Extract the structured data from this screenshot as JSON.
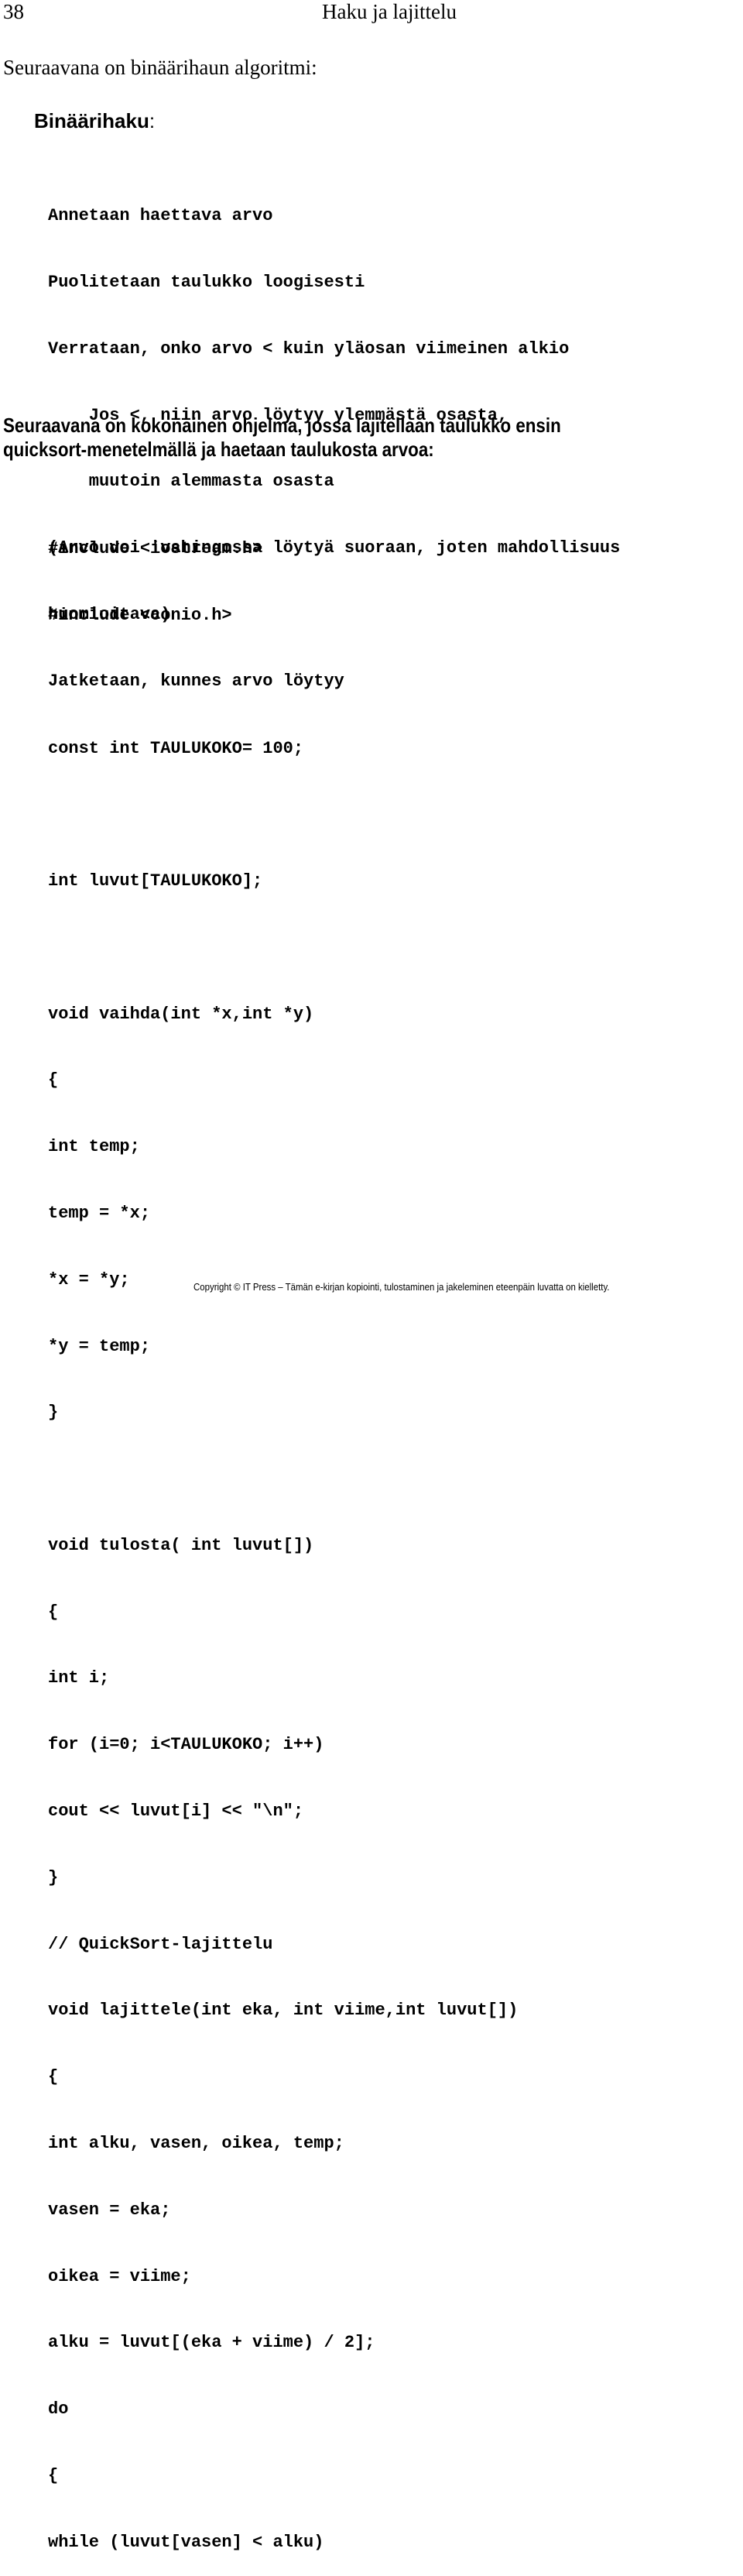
{
  "header": {
    "page_number": "38",
    "running_title": "Haku ja lajittelu"
  },
  "intro_text": "Seuraavana on binäärihaun algoritmi:",
  "algorithm": {
    "title": "Binäärihaku",
    "title_suffix": ":",
    "lines": [
      "Annetaan haettava arvo",
      "Puolitetaan taulukko loogisesti",
      "Verrataan, onko arvo < kuin yläosan viimeinen alkio",
      "    Jos <, niin arvo löytyy ylemmästä osasta,",
      "    muutoin alemmasta osasta",
      "(Arvo voi 'vahingossa löytyä suoraan, joten mahdollisuus",
      "huomioitava)",
      "Jatketaan, kunnes arvo löytyy"
    ]
  },
  "program_intro": {
    "line1": "Seuraavana on kokonainen ohjelma, jossa lajitellaan taulukko ensin",
    "line2": "quicksort-menetelmällä ja haetaan taulukosta arvoa:"
  },
  "program": {
    "includes": [
      "#include <iostream.h>",
      "#include <conio.h>"
    ],
    "const_decl": "const int TAULUKOKO= 100;",
    "array_decl": "int luvut[TAULUKOKO];",
    "swap_function": [
      "void vaihda(int *x,int *y)",
      "{",
      "int temp;",
      "temp = *x;",
      "*x = *y;",
      "*y = temp;",
      "}"
    ],
    "print_function": [
      "void tulosta( int luvut[])",
      "{",
      "int i;",
      "for (i=0; i<TAULUKOKO; i++)",
      "cout << luvut[i] << \"\\n\";",
      "}"
    ],
    "sort_function": [
      "// QuickSort-lajittelu",
      "void lajittele(int eka, int viime,int luvut[])",
      "{",
      "int alku, vasen, oikea, temp;",
      "vasen = eka;",
      "oikea = viime;",
      "alku = luvut[(eka + viime) / 2];",
      "do",
      "{",
      "while (luvut[vasen] < alku)"
    ]
  },
  "footer": {
    "copyright": "Copyright © IT Press – Tämän e-kirjan kopiointi, tulostaminen ja jakeleminen eteenpäin luvatta on kielletty."
  }
}
